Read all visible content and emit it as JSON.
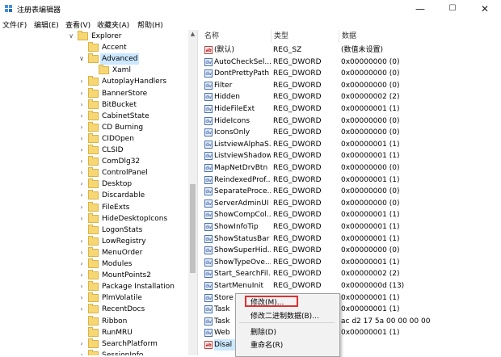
{
  "window": {
    "title": "注册表编辑器",
    "minimize": "—",
    "maximize": "☐",
    "close": "✕"
  },
  "menu": [
    "文件(F)",
    "编辑(E)",
    "查看(V)",
    "收藏夹(A)",
    "帮助(H)"
  ],
  "tree": [
    {
      "label": "Explorer",
      "exp": "∨"
    },
    {
      "label": "Accent",
      "exp": ""
    },
    {
      "label": "Advanced",
      "exp": "∨"
    },
    {
      "label": "Xaml",
      "exp": ""
    },
    {
      "label": "AutoplayHandlers",
      "exp": "›"
    },
    {
      "label": "BannerStore",
      "exp": "›"
    },
    {
      "label": "BitBucket",
      "exp": "›"
    },
    {
      "label": "CabinetState",
      "exp": "›"
    },
    {
      "label": "CD Burning",
      "exp": "›"
    },
    {
      "label": "CIDOpen",
      "exp": "›"
    },
    {
      "label": "CLSID",
      "exp": "›"
    },
    {
      "label": "ComDlg32",
      "exp": "›"
    },
    {
      "label": "ControlPanel",
      "exp": "›"
    },
    {
      "label": "Desktop",
      "exp": "›"
    },
    {
      "label": "Discardable",
      "exp": "›"
    },
    {
      "label": "FileExts",
      "exp": "›"
    },
    {
      "label": "HideDesktopIcons",
      "exp": "›"
    },
    {
      "label": "LogonStats",
      "exp": ""
    },
    {
      "label": "LowRegistry",
      "exp": "›"
    },
    {
      "label": "MenuOrder",
      "exp": "›"
    },
    {
      "label": "Modules",
      "exp": "›"
    },
    {
      "label": "MountPoints2",
      "exp": "›"
    },
    {
      "label": "Package Installation",
      "exp": "›"
    },
    {
      "label": "PlmVolatile",
      "exp": "›"
    },
    {
      "label": "RecentDocs",
      "exp": "›"
    },
    {
      "label": "Ribbon",
      "exp": ""
    },
    {
      "label": "RunMRU",
      "exp": ""
    },
    {
      "label": "SearchPlatform",
      "exp": "›"
    },
    {
      "label": "SessionInfo",
      "exp": "›"
    }
  ],
  "columns": {
    "name": "名称",
    "type": "类型",
    "data": "数据"
  },
  "values": [
    {
      "icon": "ab",
      "name": "(默认)",
      "type": "REG_SZ",
      "data": "(数值未设置)"
    },
    {
      "icon": "dw",
      "name": "AutoCheckSel...",
      "type": "REG_DWORD",
      "data": "0x00000000 (0)"
    },
    {
      "icon": "dw",
      "name": "DontPrettyPath",
      "type": "REG_DWORD",
      "data": "0x00000000 (0)"
    },
    {
      "icon": "dw",
      "name": "Filter",
      "type": "REG_DWORD",
      "data": "0x00000000 (0)"
    },
    {
      "icon": "dw",
      "name": "Hidden",
      "type": "REG_DWORD",
      "data": "0x00000002 (2)"
    },
    {
      "icon": "dw",
      "name": "HideFileExt",
      "type": "REG_DWORD",
      "data": "0x00000001 (1)"
    },
    {
      "icon": "dw",
      "name": "HideIcons",
      "type": "REG_DWORD",
      "data": "0x00000000 (0)"
    },
    {
      "icon": "dw",
      "name": "IconsOnly",
      "type": "REG_DWORD",
      "data": "0x00000000 (0)"
    },
    {
      "icon": "dw",
      "name": "ListviewAlphaS...",
      "type": "REG_DWORD",
      "data": "0x00000001 (1)"
    },
    {
      "icon": "dw",
      "name": "ListviewShadow",
      "type": "REG_DWORD",
      "data": "0x00000001 (1)"
    },
    {
      "icon": "dw",
      "name": "MapNetDrvBtn",
      "type": "REG_DWORD",
      "data": "0x00000000 (0)"
    },
    {
      "icon": "dw",
      "name": "ReindexedProf...",
      "type": "REG_DWORD",
      "data": "0x00000001 (1)"
    },
    {
      "icon": "dw",
      "name": "SeparateProce...",
      "type": "REG_DWORD",
      "data": "0x00000000 (0)"
    },
    {
      "icon": "dw",
      "name": "ServerAdminUI",
      "type": "REG_DWORD",
      "data": "0x00000000 (0)"
    },
    {
      "icon": "dw",
      "name": "ShowCompCol...",
      "type": "REG_DWORD",
      "data": "0x00000001 (1)"
    },
    {
      "icon": "dw",
      "name": "ShowInfoTip",
      "type": "REG_DWORD",
      "data": "0x00000001 (1)"
    },
    {
      "icon": "dw",
      "name": "ShowStatusBar",
      "type": "REG_DWORD",
      "data": "0x00000001 (1)"
    },
    {
      "icon": "dw",
      "name": "ShowSuperHid...",
      "type": "REG_DWORD",
      "data": "0x00000000 (0)"
    },
    {
      "icon": "dw",
      "name": "ShowTypeOve...",
      "type": "REG_DWORD",
      "data": "0x00000001 (1)"
    },
    {
      "icon": "dw",
      "name": "Start_SearchFil...",
      "type": "REG_DWORD",
      "data": "0x00000002 (2)"
    },
    {
      "icon": "dw",
      "name": "StartMenuInit",
      "type": "REG_DWORD",
      "data": "0x0000000d (13)"
    },
    {
      "icon": "dw",
      "name": "Store",
      "type": "",
      "data": "0x00000001 (1)"
    },
    {
      "icon": "dw",
      "name": "Task",
      "type": "",
      "data": "0x00000001 (1)"
    },
    {
      "icon": "dw",
      "name": "Task",
      "type": "",
      "data": "ac d2 17 5a 00 00 00 00"
    },
    {
      "icon": "dw",
      "name": "Web",
      "type": "",
      "data": "0x00000001 (1)"
    },
    {
      "icon": "ab",
      "name": "Disal",
      "type": "",
      "data": ""
    }
  ],
  "context_menu": {
    "modify": "修改(M)...",
    "modify_binary": "修改二进制数据(B)...",
    "delete": "删除(D)",
    "rename": "重命名(R)"
  }
}
